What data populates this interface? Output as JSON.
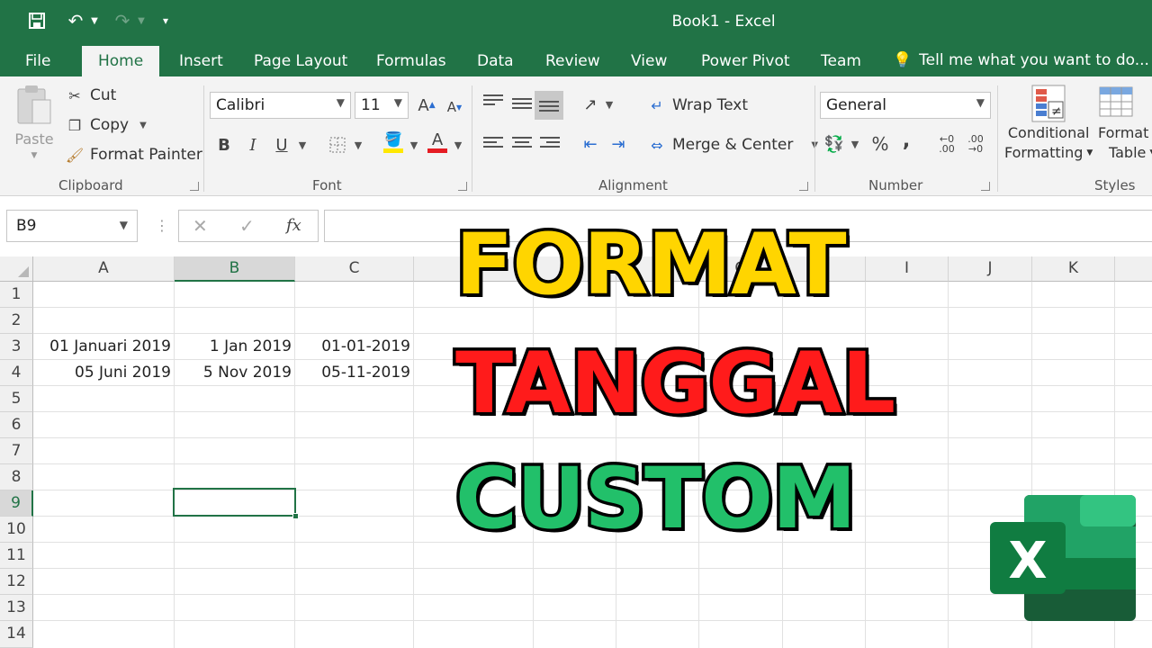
{
  "titlebar": {
    "title": "Book1  -  Excel",
    "qat": {
      "save": "save-icon",
      "undo": "undo-icon",
      "redo": "redo-icon",
      "customize": "dropdown-icon"
    }
  },
  "tabs": [
    "File",
    "Home",
    "Insert",
    "Page Layout",
    "Formulas",
    "Data",
    "Review",
    "View",
    "Power Pivot",
    "Team"
  ],
  "active_tab": "Home",
  "tell_me": "Tell me what you want to do...",
  "ribbon": {
    "clipboard": {
      "label": "Clipboard",
      "paste": "Paste",
      "cut": "Cut",
      "copy": "Copy",
      "format_painter": "Format Painter"
    },
    "font": {
      "label": "Font",
      "name": "Calibri",
      "size": "11",
      "bold": "B",
      "italic": "I",
      "underline": "U",
      "font_color": "A"
    },
    "alignment": {
      "label": "Alignment",
      "wrap": "Wrap Text",
      "merge": "Merge & Center"
    },
    "number": {
      "label": "Number",
      "format": "General",
      "percent": "%",
      "comma": ","
    },
    "styles": {
      "label": "Styles",
      "cond1": "Conditional",
      "cond2": "Formatting",
      "fmt1": "Format",
      "fmt2": "Table"
    }
  },
  "formula_bar": {
    "name_box": "B9",
    "cancel": "✕",
    "enter": "✓",
    "fx": "fx"
  },
  "grid": {
    "columns": [
      "A",
      "B",
      "C",
      "D",
      "E",
      "F",
      "G",
      "H",
      "I",
      "J",
      "K"
    ],
    "selected_column": "B",
    "rows": [
      "1",
      "2",
      "3",
      "4",
      "5",
      "6",
      "7",
      "8",
      "9",
      "10",
      "11",
      "12",
      "13",
      "14"
    ],
    "selected_row": "9",
    "cells": {
      "A3": "01 Januari 2019",
      "B3": "1 Jan 2019",
      "C3": "01-01-2019",
      "A4": "05 Juni 2019",
      "B4": "5 Nov 2019",
      "C4": "05-11-2019"
    }
  },
  "overlay": {
    "line1": "FORMAT",
    "line2": "TANGGAL",
    "line3": "CUSTOM"
  },
  "colors": {
    "excel_green": "#217346",
    "yellow": "#ffd500",
    "red": "#ff1b1b",
    "green": "#22c06a"
  },
  "logo": {
    "letter": "X"
  }
}
